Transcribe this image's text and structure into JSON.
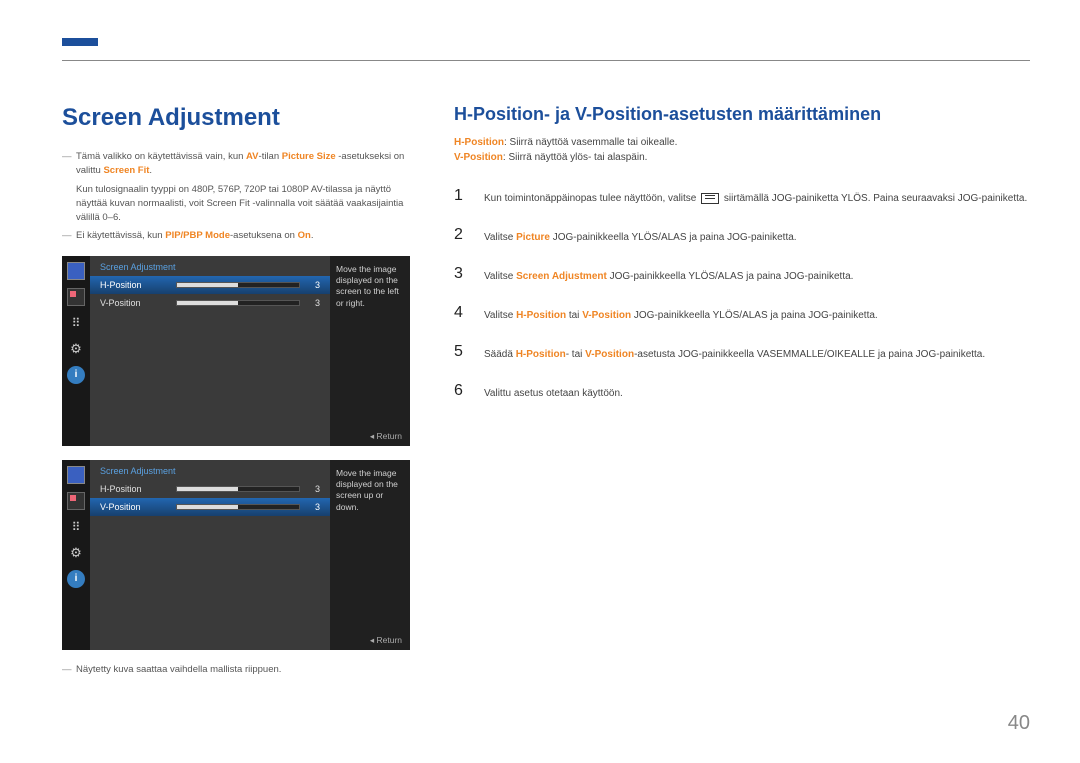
{
  "pageNumber": "40",
  "left": {
    "title": "Screen Adjustment",
    "note1_before": "Tämä valikko on käytettävissä vain, kun ",
    "note1_hl1": "AV",
    "note1_mid1": "-tilan ",
    "note1_hl2": "Picture Size",
    "note1_mid2": " -asetukseksi on valittu ",
    "note1_hl3": "Screen Fit",
    "note1_end": ".",
    "note1_sub_before": "Kun tulosignaalin tyyppi on 480P, 576P, 720P tai 1080P ",
    "note1_sub_hl1": "AV",
    "note1_sub_mid": "-tilassa ja näyttö näyttää kuvan normaalisti, voit ",
    "note1_sub_hl2": "Screen Fit",
    "note1_sub_end": " -valinnalla voit säätää vaakasijaintia välillä 0–6.",
    "note2_before": "Ei käytettävissä, kun ",
    "note2_hl1": "PIP/PBP Mode",
    "note2_mid": "-asetuksena on ",
    "note2_hl2": "On",
    "note2_end": ".",
    "osd_header": "Screen Adjustment",
    "row_h": "H-Position",
    "row_v": "V-Position",
    "val": "3",
    "tooltip1": "Move the image displayed on the screen to the left or right.",
    "tooltip2": "Move the image displayed on the screen up or down.",
    "return": "Return",
    "caption": "Näytetty kuva saattaa vaihdella mallista riippuen."
  },
  "right": {
    "title": "H-Position- ja V-Position-asetusten määrittäminen",
    "def1_hl": "H-Position",
    "def1_txt": ": Siirrä näyttöä vasemmalle tai oikealle.",
    "def2_hl": "V-Position",
    "def2_txt": ": Siirrä näyttöä ylös- tai alaspäin.",
    "steps": [
      {
        "n": "1",
        "before": "Kun toimintonäppäinopas tulee näyttöön, valitse ",
        "icon": true,
        "after": " siirtämällä JOG-painiketta YLÖS. Paina seuraavaksi JOG-painiketta."
      },
      {
        "n": "2",
        "before": "Valitse ",
        "hl": "Picture",
        "after": " JOG-painikkeella YLÖS/ALAS ja paina JOG-painiketta."
      },
      {
        "n": "3",
        "before": "Valitse ",
        "hl": "Screen Adjustment",
        "after": " JOG-painikkeella YLÖS/ALAS ja paina JOG-painiketta."
      },
      {
        "n": "4",
        "before": "Valitse ",
        "hl": "H-Position",
        "mid": " tai ",
        "hl2": "V-Position",
        "after": " JOG-painikkeella YLÖS/ALAS ja paina JOG-painiketta."
      },
      {
        "n": "5",
        "before": "Säädä ",
        "hl": "H-Position",
        "mid": "- tai ",
        "hl2": "V-Position",
        "after": "-asetusta JOG-painikkeella VASEMMALLE/OIKEALLE ja paina JOG-painiketta."
      },
      {
        "n": "6",
        "before": "Valittu asetus otetaan käyttöön."
      }
    ]
  }
}
